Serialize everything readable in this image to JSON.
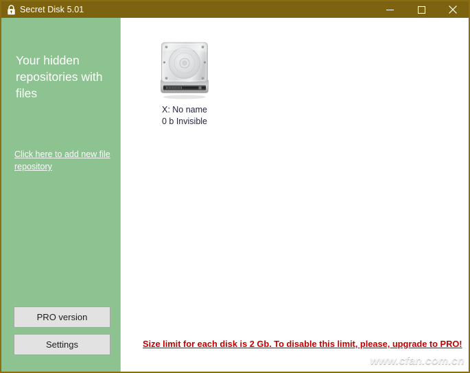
{
  "window": {
    "title": "Secret Disk 5.01",
    "lock_icon": "lock-icon",
    "controls": {
      "minimize": "minimize-icon",
      "maximize": "maximize-icon",
      "close": "close-icon"
    },
    "colors": {
      "titlebar": "#7d6310",
      "border": "#8a6d11",
      "sidebar": "#8dc291",
      "content": "#ffffff",
      "notice": "#c00000",
      "button_face": "#e2e2e2"
    }
  },
  "sidebar": {
    "heading": "Your hidden repositories with files",
    "add_repository_link": "Click here to add new file repository",
    "buttons": {
      "pro_version": "PRO version",
      "settings": "Settings"
    }
  },
  "main": {
    "disks": [
      {
        "icon": "hard-disk-icon",
        "name_line": "X: No name",
        "status_line": "0 b Invisible"
      }
    ],
    "size_limit_notice": "Size limit for each disk is 2 Gb. To disable this limit, please, upgrade to PRO!",
    "watermark": "www.cfan.com.cn"
  }
}
